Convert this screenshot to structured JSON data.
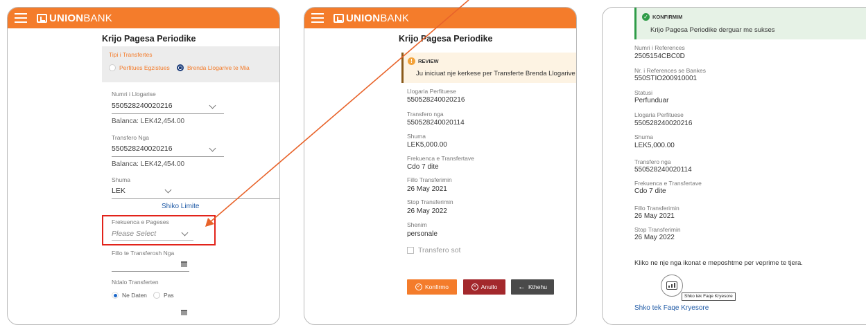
{
  "brand": {
    "bold": "UNION",
    "light": "BANK"
  },
  "colors": {
    "accent": "#f47c2b",
    "success": "#2e9c47",
    "danger": "#a3282c",
    "dark": "#4a4a4a"
  },
  "screen1": {
    "title": "Krijo Pagesa Periodike",
    "transfer_type_label": "Tipi i Transfertes",
    "option1": "Perfitues Egzistues",
    "option2": "Brenda Llogarive te Mia",
    "account_label": "Numri i Llogarise",
    "account_value": "550528240020216",
    "balance1": "Balanca: LEK42,454.00",
    "from_label": "Transfero Nga",
    "from_value": "550528240020216",
    "balance2": "Balanca: LEK42,454.00",
    "amount_label": "Shuma",
    "currency": "LEK",
    "limits_link": "Shiko Limite",
    "freq_label": "Frekuenca e Pageses",
    "freq_placeholder": "Please Select",
    "start_label": "Fillo te Transferosh Nga",
    "stop_label": "Ndalo Transferten",
    "stop_opt1": "Ne Daten",
    "stop_opt2": "Pas"
  },
  "screen2": {
    "title": "Krijo Pagesa Periodike",
    "review_title": "REVIEW",
    "review_text": "Ju iniciuat nje kerkese per Transferte Brenda Llogarive te",
    "beneficiary_label": "Llogaria Perfituese",
    "beneficiary_value": "550528240020216",
    "from_label": "Transfero nga",
    "from_value": "550528240020114",
    "amount_label": "Shuma",
    "amount_value": "LEK5,000.00",
    "freq_label": "Frekuenca e Transfertave",
    "freq_value": "Cdo 7 dite",
    "start_label": "Fillo Transferimin",
    "start_value": "26 May 2021",
    "stop_label": "Stop Transferimin",
    "stop_value": "26 May 2022",
    "note_label": "Shenim",
    "note_value": "personale",
    "today_label": "Transfero sot",
    "confirm": "Konfirmo",
    "cancel": "Anullo",
    "back": "Kthehu"
  },
  "screen3": {
    "confirm_title": "KONFIRMIM",
    "confirm_text": "Krijo Pagesa Periodike derguar me sukses",
    "ref_label": "Numri i References",
    "ref_value": "2505154CBC0D",
    "bank_ref_label": "Nr. i References se Bankes",
    "bank_ref_value": "550STIO200910001",
    "status_label": "Statusi",
    "status_value": "Perfunduar",
    "beneficiary_label": "Llogaria Perfituese",
    "beneficiary_value": "550528240020216",
    "amount_label": "Shuma",
    "amount_value": "LEK5,000.00",
    "from_label": "Transfero nga",
    "from_value": "550528240020114",
    "freq_label": "Frekuenca e Transfertave",
    "freq_value": "Cdo 7 dite",
    "start_label": "Fillo Transferimin",
    "start_value": "26 May 2021",
    "stop_label": "Stop Transferimin",
    "stop_value": "26 May 2022",
    "hint": "Kliko ne nje nga ikonat e meposhtme per veprime te tjera.",
    "tooltip": "Shko tek Faqe Kryesore",
    "home_link": "Shko tek Faqe Kryesore"
  }
}
